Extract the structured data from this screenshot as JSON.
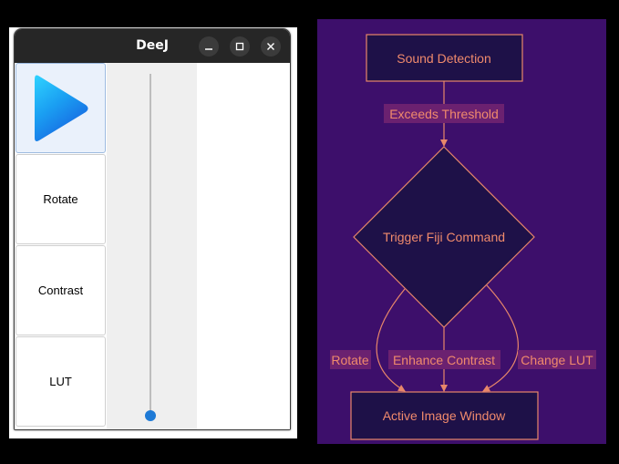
{
  "window": {
    "title": "DeeJ",
    "buttons": [
      "minimize-icon",
      "maximize-icon",
      "close-icon"
    ]
  },
  "toolbar": {
    "play_icon": "play-icon",
    "rotate_label": "Rotate",
    "contrast_label": "Contrast",
    "lut_label": "LUT"
  },
  "slider": {
    "value_fraction": 0.0
  },
  "flowchart": {
    "nodes": {
      "sound_detection": "Sound Detection",
      "trigger_fiji": "Trigger Fiji Command",
      "active_image": "Active Image Window"
    },
    "edges": {
      "exceeds_threshold": "Exceeds Threshold",
      "rotate": "Rotate",
      "enhance_contrast": "Enhance Contrast",
      "change_lut": "Change LUT"
    },
    "colors": {
      "background": "#3d0f6b",
      "node_fill": "#1e1148",
      "stroke": "#e8876a",
      "text": "#f08a6c",
      "label_bg": "#6b2170"
    }
  }
}
